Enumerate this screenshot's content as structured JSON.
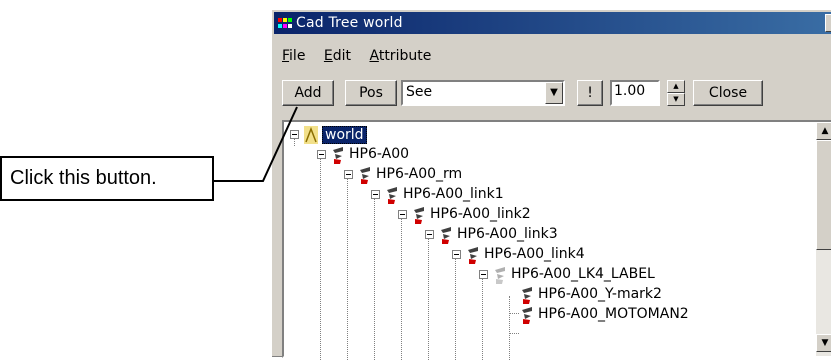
{
  "window": {
    "title": "Cad Tree world",
    "close_glyph": "×"
  },
  "menu": [
    {
      "key": "F",
      "rest": "ile"
    },
    {
      "key": "E",
      "rest": "dit"
    },
    {
      "key": "A",
      "rest": "ttribute"
    }
  ],
  "toolbar": {
    "add_label": "Add",
    "pos_label": "Pos",
    "combo_value": "See",
    "bang_label": "!",
    "number_value": "1.00",
    "close_label": "Close"
  },
  "tree": {
    "items": [
      {
        "label": "world",
        "depth": 0,
        "expanded": true,
        "selected": true,
        "icon": "root-icon"
      },
      {
        "label": "HP6-A00",
        "depth": 1,
        "expanded": true,
        "icon": "robot-icon"
      },
      {
        "label": "HP6-A00_rm",
        "depth": 2,
        "expanded": true,
        "icon": "robot-icon"
      },
      {
        "label": "HP6-A00_link1",
        "depth": 3,
        "expanded": true,
        "icon": "robot-icon"
      },
      {
        "label": "HP6-A00_link2",
        "depth": 4,
        "expanded": true,
        "icon": "robot-icon"
      },
      {
        "label": "HP6-A00_link3",
        "depth": 5,
        "expanded": true,
        "icon": "robot-icon"
      },
      {
        "label": "HP6-A00_link4",
        "depth": 6,
        "expanded": true,
        "icon": "robot-icon"
      },
      {
        "label": "HP6-A00_LK4_LABEL",
        "depth": 7,
        "expanded": true,
        "icon": "robot-gray-icon"
      },
      {
        "label": "HP6-A00_Y-mark2",
        "depth": 8,
        "expanded": false,
        "icon": "robot-icon"
      },
      {
        "label": "HP6-A00_MOTOMAN2",
        "depth": 8,
        "expanded": false,
        "icon": "robot-icon"
      }
    ]
  },
  "callout": {
    "text": "Click this button."
  }
}
